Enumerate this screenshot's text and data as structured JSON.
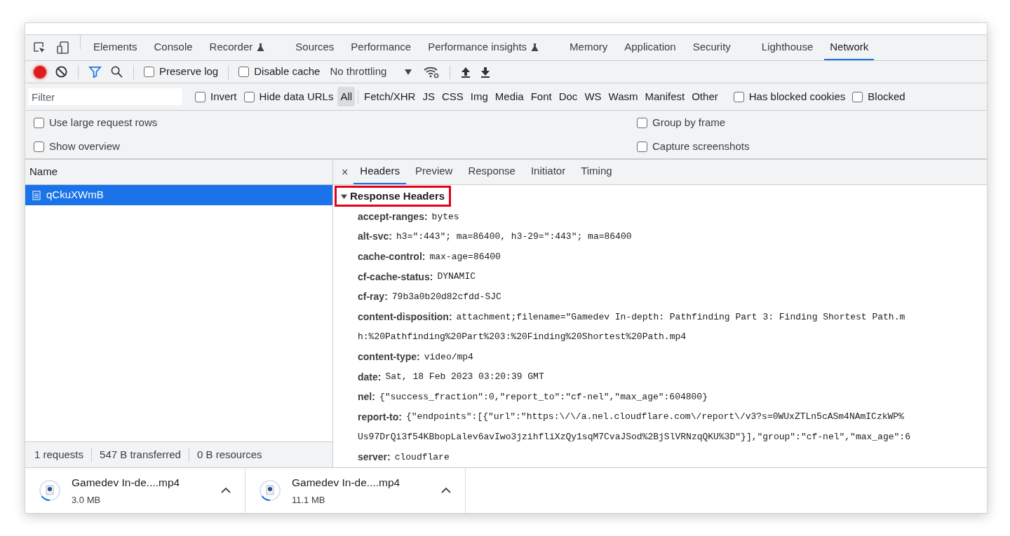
{
  "main_tabs": [
    {
      "label": "Elements",
      "selected": false,
      "experimental": false
    },
    {
      "label": "Console",
      "selected": false,
      "experimental": false
    },
    {
      "label": "Recorder",
      "selected": false,
      "experimental": true
    },
    {
      "label": "Sources",
      "selected": false,
      "experimental": false
    },
    {
      "label": "Performance",
      "selected": false,
      "experimental": false
    },
    {
      "label": "Performance insights",
      "selected": false,
      "experimental": true
    },
    {
      "label": "Memory",
      "selected": false,
      "experimental": false
    },
    {
      "label": "Application",
      "selected": false,
      "experimental": false
    },
    {
      "label": "Security",
      "selected": false,
      "experimental": false
    },
    {
      "label": "Lighthouse",
      "selected": false,
      "experimental": false
    },
    {
      "label": "Network",
      "selected": true,
      "experimental": false
    }
  ],
  "toolbar": {
    "recording": true,
    "filter_active": true,
    "preserve_log": {
      "label": "Preserve log",
      "checked": false
    },
    "disable_cache": {
      "label": "Disable cache",
      "checked": false
    },
    "throttling": "No throttling"
  },
  "filter_bar": {
    "placeholder": "Filter",
    "invert": {
      "label": "Invert",
      "checked": false
    },
    "hide_data_urls": {
      "label": "Hide data URLs",
      "checked": false
    },
    "types": [
      {
        "label": "All",
        "selected": true
      },
      {
        "label": "Fetch/XHR",
        "selected": false
      },
      {
        "label": "JS",
        "selected": false
      },
      {
        "label": "CSS",
        "selected": false
      },
      {
        "label": "Img",
        "selected": false
      },
      {
        "label": "Media",
        "selected": false
      },
      {
        "label": "Font",
        "selected": false
      },
      {
        "label": "Doc",
        "selected": false
      },
      {
        "label": "WS",
        "selected": false
      },
      {
        "label": "Wasm",
        "selected": false
      },
      {
        "label": "Manifest",
        "selected": false
      },
      {
        "label": "Other",
        "selected": false
      }
    ],
    "has_blocked_cookies": {
      "label": "Has blocked cookies",
      "checked": false
    },
    "blocked": {
      "label": "Blocked",
      "checked": false
    }
  },
  "settings": {
    "left": [
      {
        "label": "Use large request rows",
        "checked": false
      },
      {
        "label": "Show overview",
        "checked": false
      }
    ],
    "right": [
      {
        "label": "Group by frame",
        "checked": false
      },
      {
        "label": "Capture screenshots",
        "checked": false
      }
    ]
  },
  "requests": {
    "column": "Name",
    "rows": [
      {
        "name": "qCkuXWmB",
        "selected": true
      }
    ]
  },
  "detail_close": "×",
  "detail_tabs": [
    {
      "label": "Headers",
      "selected": true
    },
    {
      "label": "Preview",
      "selected": false
    },
    {
      "label": "Response",
      "selected": false
    },
    {
      "label": "Initiator",
      "selected": false
    },
    {
      "label": "Timing",
      "selected": false
    }
  ],
  "section": {
    "title": "Response Headers",
    "expanded": true,
    "highlighted": true
  },
  "headers": [
    {
      "name": "accept-ranges:",
      "lines": [
        "bytes"
      ]
    },
    {
      "name": "alt-svc:",
      "lines": [
        "h3=\":443\"; ma=86400, h3-29=\":443\"; ma=86400"
      ]
    },
    {
      "name": "cache-control:",
      "lines": [
        "max-age=86400"
      ]
    },
    {
      "name": "cf-cache-status:",
      "lines": [
        "DYNAMIC"
      ]
    },
    {
      "name": "cf-ray:",
      "lines": [
        "79b3a0b20d82cfdd-SJC"
      ]
    },
    {
      "name": "content-disposition:",
      "lines": [
        "attachment;filename=\"Gamedev In-depth: Pathfinding Part 3: Finding Shortest Path.m",
        "h:%20Pathfinding%20Part%203:%20Finding%20Shortest%20Path.mp4"
      ]
    },
    {
      "name": "content-type:",
      "lines": [
        "video/mp4"
      ]
    },
    {
      "name": "date:",
      "lines": [
        "Sat, 18 Feb 2023 03:20:39 GMT"
      ]
    },
    {
      "name": "nel:",
      "lines": [
        "{\"success_fraction\":0,\"report_to\":\"cf-nel\",\"max_age\":604800}"
      ]
    },
    {
      "name": "report-to:",
      "lines": [
        "{\"endpoints\":[{\"url\":\"https:\\/\\/a.nel.cloudflare.com\\/report\\/v3?s=0WUxZTLn5cASm4NAmICzkWP%",
        "Us97DrQi3f54KBbopLalev6avIwo3jzihfliXzQy1sqM7CvaJSod%2BjSlVRNzqQKU%3D\"}],\"group\":\"cf-nel\",\"max_age\":6"
      ]
    },
    {
      "name": "server:",
      "lines": [
        "cloudflare"
      ]
    }
  ],
  "status_bar": [
    "1 requests",
    "547 B transferred",
    "0 B resources"
  ],
  "downloads": [
    {
      "name": "Gamedev In-de....mp4",
      "size": "3.0 MB",
      "level": 0.15
    },
    {
      "name": "Gamedev In-de....mp4",
      "size": "11.1 MB",
      "level": 0.15
    }
  ]
}
